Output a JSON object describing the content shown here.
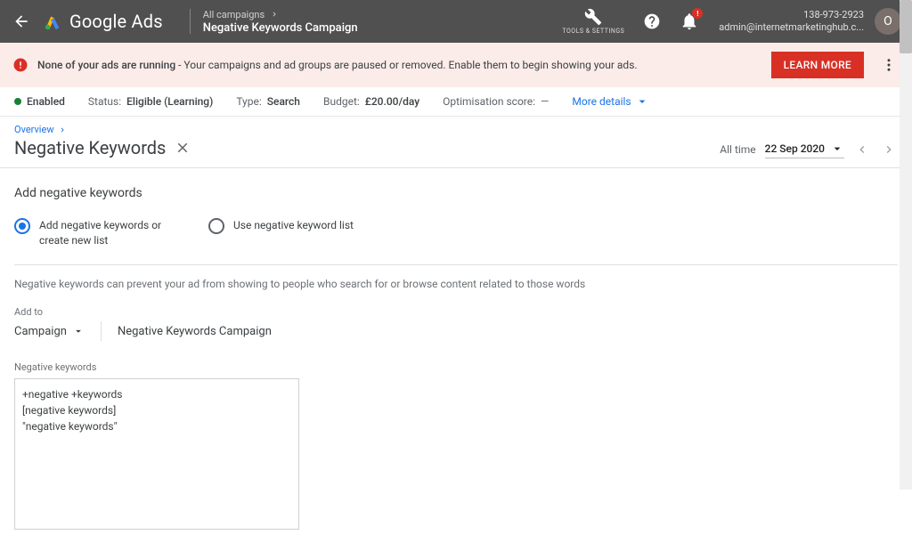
{
  "header": {
    "product": "Google Ads",
    "breadcrumb_top": "All campaigns",
    "breadcrumb_bottom": "Negative Keywords Campaign",
    "tools_label": "TOOLS & SETTINGS",
    "notif_badge": "!",
    "account_phone": "138-973-2923",
    "account_email": "admin@internetmarketinghub.c...",
    "avatar_initial": "O"
  },
  "alert": {
    "bold": "None of your ads are running",
    "rest": " - Your campaigns and ad groups are paused or removed. Enable them to begin showing your ads.",
    "cta": "LEARN MORE"
  },
  "status_bar": {
    "enabled": "Enabled",
    "status_lbl": "Status:",
    "status_val": "Eligible (Learning)",
    "type_lbl": "Type:",
    "type_val": "Search",
    "budget_lbl": "Budget:",
    "budget_val": "£20.00/day",
    "opt_lbl": "Optimisation score:",
    "opt_val": "—",
    "more": "More details"
  },
  "subheader": {
    "crumb": "Overview",
    "title": "Negative Keywords",
    "date_label": "All time",
    "date_value": "22 Sep 2020"
  },
  "content": {
    "heading": "Add negative keywords",
    "radio1": "Add negative keywords or create new list",
    "radio2": "Use negative keyword list",
    "help_text": "Negative keywords can prevent your ad from showing to people who search for or browse content related to those words",
    "addto_label": "Add to",
    "addto_selector": "Campaign",
    "campaign_name": "Negative Keywords Campaign",
    "kw_label": "Negative keywords",
    "kw_value": "+negative +keywords\n[negative keywords]\n\"negative keywords\""
  }
}
